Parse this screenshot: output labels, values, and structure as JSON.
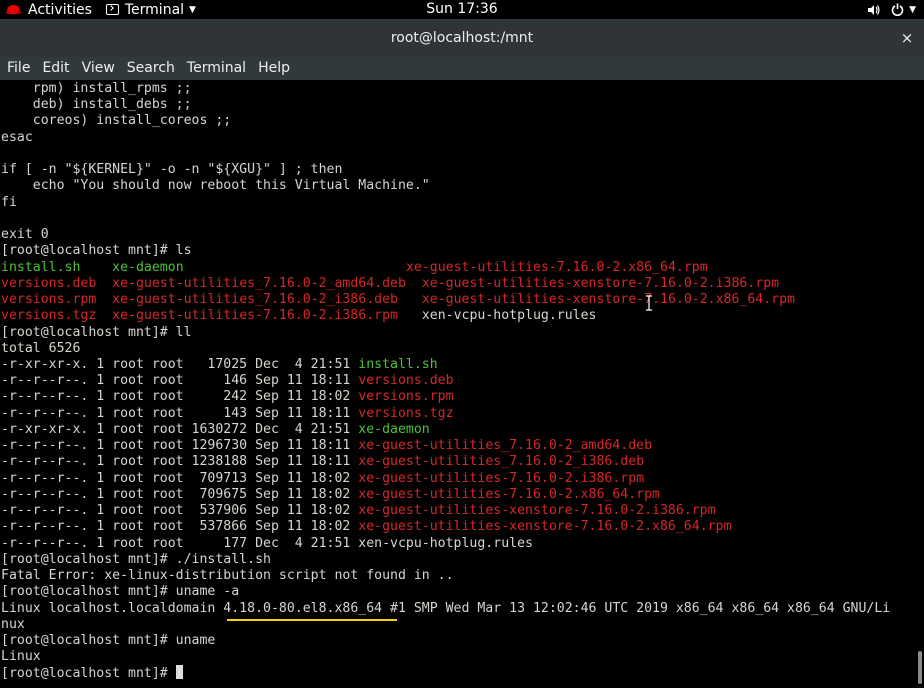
{
  "topbar": {
    "activities": "Activities",
    "app_menu": "Terminal",
    "clock": "Sun 17:36",
    "volume_icon": "speaker-icon",
    "power_icon": "power-icon"
  },
  "window": {
    "title": "root@localhost:/mnt",
    "close_label": "×"
  },
  "menu": [
    "File",
    "Edit",
    "View",
    "Search",
    "Terminal",
    "Help"
  ],
  "terminal": {
    "lines": [
      [
        {
          "t": "    rpm) install_rpms ;;",
          "c": "w"
        }
      ],
      [
        {
          "t": "    deb) install_debs ;;",
          "c": "w"
        }
      ],
      [
        {
          "t": "    coreos) install_coreos ;;",
          "c": "w"
        }
      ],
      [
        {
          "t": "esac",
          "c": "w"
        }
      ],
      [
        {
          "t": "",
          "c": "w"
        }
      ],
      [
        {
          "t": "if [ -n \"${KERNEL}\" -o -n \"${XGU}\" ] ; then",
          "c": "w"
        }
      ],
      [
        {
          "t": "    echo \"You should now reboot this Virtual Machine.\"",
          "c": "w"
        }
      ],
      [
        {
          "t": "fi",
          "c": "w"
        }
      ],
      [
        {
          "t": "",
          "c": "w"
        }
      ],
      [
        {
          "t": "exit 0",
          "c": "w"
        }
      ],
      [
        {
          "t": "[root@localhost mnt]# ls",
          "c": "w"
        }
      ],
      [
        {
          "t": "install.sh",
          "c": "g"
        },
        {
          "t": "    ",
          "c": "w"
        },
        {
          "t": "xe-daemon",
          "c": "g"
        },
        {
          "t": "                            ",
          "c": "w"
        },
        {
          "t": "xe-guest-utilities-7.16.0-2.x86_64.rpm",
          "c": "r"
        }
      ],
      [
        {
          "t": "versions.deb",
          "c": "r"
        },
        {
          "t": "  ",
          "c": "w"
        },
        {
          "t": "xe-guest-utilities_7.16.0-2_amd64.deb",
          "c": "r"
        },
        {
          "t": "  ",
          "c": "w"
        },
        {
          "t": "xe-guest-utilities-xenstore-7.16.0-2.i386.rpm",
          "c": "r"
        }
      ],
      [
        {
          "t": "versions.rpm",
          "c": "r"
        },
        {
          "t": "  ",
          "c": "w"
        },
        {
          "t": "xe-guest-utilities_7.16.0-2_i386.deb",
          "c": "r"
        },
        {
          "t": "   ",
          "c": "w"
        },
        {
          "t": "xe-guest-utilities-xenstore-7.16.0-2.x86_64.rpm",
          "c": "r"
        }
      ],
      [
        {
          "t": "versions.tgz",
          "c": "r"
        },
        {
          "t": "  ",
          "c": "w"
        },
        {
          "t": "xe-guest-utilities-7.16.0-2.i386.rpm",
          "c": "r"
        },
        {
          "t": "   ",
          "c": "w"
        },
        {
          "t": "xen-vcpu-hotplug.rules",
          "c": "w"
        }
      ],
      [
        {
          "t": "[root@localhost mnt]# ll",
          "c": "w"
        }
      ],
      [
        {
          "t": "total 6526",
          "c": "w"
        }
      ],
      [
        {
          "t": "-r-xr-xr-x. 1 root root   17025 Dec  4 21:51 ",
          "c": "w"
        },
        {
          "t": "install.sh",
          "c": "g"
        }
      ],
      [
        {
          "t": "-r--r--r--. 1 root root     146 Sep 11 18:11 ",
          "c": "w"
        },
        {
          "t": "versions.deb",
          "c": "r"
        }
      ],
      [
        {
          "t": "-r--r--r--. 1 root root     242 Sep 11 18:02 ",
          "c": "w"
        },
        {
          "t": "versions.rpm",
          "c": "r"
        }
      ],
      [
        {
          "t": "-r--r--r--. 1 root root     143 Sep 11 18:11 ",
          "c": "w"
        },
        {
          "t": "versions.tgz",
          "c": "r"
        }
      ],
      [
        {
          "t": "-r-xr-xr-x. 1 root root 1630272 Dec  4 21:51 ",
          "c": "w"
        },
        {
          "t": "xe-daemon",
          "c": "g"
        }
      ],
      [
        {
          "t": "-r--r--r--. 1 root root 1296730 Sep 11 18:11 ",
          "c": "w"
        },
        {
          "t": "xe-guest-utilities_7.16.0-2_amd64.deb",
          "c": "r"
        }
      ],
      [
        {
          "t": "-r--r--r--. 1 root root 1238188 Sep 11 18:11 ",
          "c": "w"
        },
        {
          "t": "xe-guest-utilities_7.16.0-2_i386.deb",
          "c": "r"
        }
      ],
      [
        {
          "t": "-r--r--r--. 1 root root  709713 Sep 11 18:02 ",
          "c": "w"
        },
        {
          "t": "xe-guest-utilities-7.16.0-2.i386.rpm",
          "c": "r"
        }
      ],
      [
        {
          "t": "-r--r--r--. 1 root root  709675 Sep 11 18:02 ",
          "c": "w"
        },
        {
          "t": "xe-guest-utilities-7.16.0-2.x86_64.rpm",
          "c": "r"
        }
      ],
      [
        {
          "t": "-r--r--r--. 1 root root  537906 Sep 11 18:02 ",
          "c": "w"
        },
        {
          "t": "xe-guest-utilities-xenstore-7.16.0-2.i386.rpm",
          "c": "r"
        }
      ],
      [
        {
          "t": "-r--r--r--. 1 root root  537866 Sep 11 18:02 ",
          "c": "w"
        },
        {
          "t": "xe-guest-utilities-xenstore-7.16.0-2.x86_64.rpm",
          "c": "r"
        }
      ],
      [
        {
          "t": "-r--r--r--. 1 root root     177 Dec  4 21:51 xen-vcpu-hotplug.rules",
          "c": "w"
        }
      ],
      [
        {
          "t": "[root@localhost mnt]# ./install.sh",
          "c": "w"
        }
      ],
      [
        {
          "t": "Fatal Error: xe-linux-distribution script not found in ..",
          "c": "w"
        }
      ],
      [
        {
          "t": "[root@localhost mnt]# uname -a",
          "c": "w"
        }
      ],
      [
        {
          "t": "Linux localhost.localdomain 4.18.0-80.el8.x86_64 #1 SMP Wed Mar 13 12:02:46 UTC 2019 x86_64 x86_64 x86_64 GNU/Li",
          "c": "w"
        }
      ],
      [
        {
          "t": "nux",
          "c": "w"
        }
      ],
      [
        {
          "t": "[root@localhost mnt]# uname",
          "c": "w"
        }
      ],
      [
        {
          "t": "Linux",
          "c": "w"
        }
      ],
      [
        {
          "t": "[root@localhost mnt]# ",
          "c": "w"
        }
      ]
    ]
  },
  "colors": {
    "green_exec": "#4ec236",
    "red_archive": "#d6262a",
    "text": "#d3d7cf",
    "highlight_underline": "#f0d500",
    "titlebar": "#2f3537"
  }
}
